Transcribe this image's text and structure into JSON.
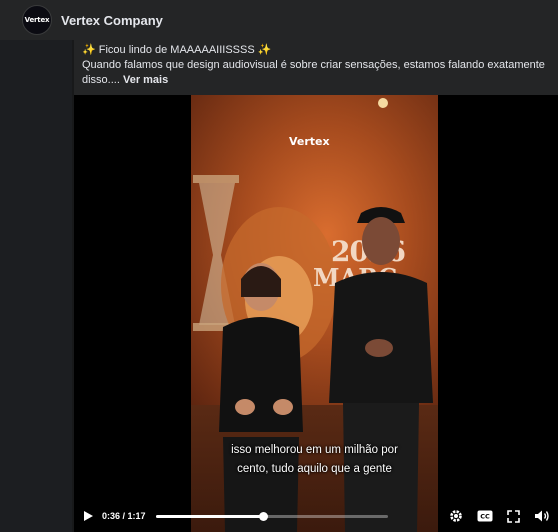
{
  "page": {
    "name": "Vertex Company",
    "avatar_text": "Vertex"
  },
  "post": {
    "sparkle_left": "✨",
    "headline": " Ficou lindo de MAAAAAIIISSSS ",
    "sparkle_right": "✨",
    "body": "Quando falamos que design audiovisual é sobre criar sensações, estamos falando exatamente disso.... ",
    "see_more": "Ver mais"
  },
  "video": {
    "screen_logo": "Vertex",
    "screen_year": "2026",
    "screen_month": "MARÇ",
    "subtitle_line1": "isso melhorou em um milhão por",
    "subtitle_line2": "cento, tudo aquilo que a gente",
    "current_time": "0:36",
    "duration": "1:17",
    "time_separator": " / ",
    "progress": 0.467
  },
  "colors": {
    "background": "#18191a",
    "header": "#242526",
    "text": "#e4e6eb",
    "accent_sparkle": "#f7d54a"
  },
  "icons": [
    "play-icon",
    "settings-icon",
    "captions-icon",
    "fullscreen-icon",
    "volume-icon"
  ]
}
